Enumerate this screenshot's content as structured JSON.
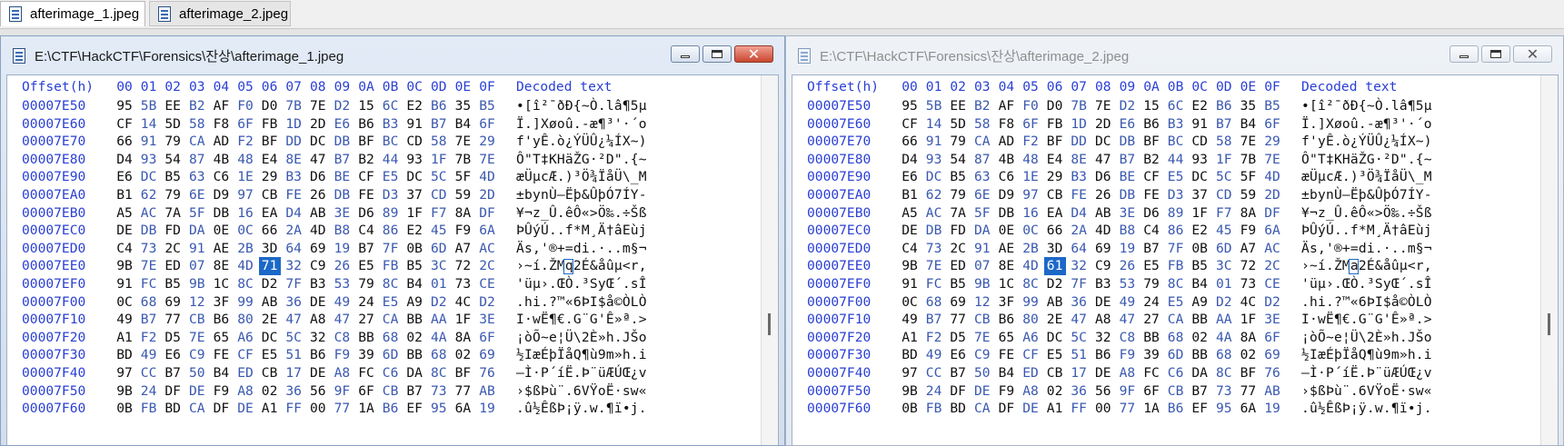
{
  "tabs": [
    {
      "label": "afterimage_1.jpeg",
      "active": true
    },
    {
      "label": "afterimage_2.jpeg",
      "active": false
    }
  ],
  "columns": {
    "offset_label": "Offset(h)",
    "hex": [
      "00",
      "01",
      "02",
      "03",
      "04",
      "05",
      "06",
      "07",
      "08",
      "09",
      "0A",
      "0B",
      "0C",
      "0D",
      "0E",
      "0F"
    ],
    "decoded_label": "Decoded text"
  },
  "windows": [
    {
      "title": "E:\\CTF\\HackCTF\\Forensics\\잔상\\afterimage_1.jpeg",
      "active": true,
      "rows": [
        {
          "offset": "00007E50",
          "bytes": [
            "95",
            "5B",
            "EE",
            "B2",
            "AF",
            "F0",
            "D0",
            "7B",
            "7E",
            "D2",
            "15",
            "6C",
            "E2",
            "B6",
            "35",
            "B5"
          ],
          "text": "•[î²¯ðÐ{~Ò.lâ¶5µ"
        },
        {
          "offset": "00007E60",
          "bytes": [
            "CF",
            "14",
            "5D",
            "58",
            "F8",
            "6F",
            "FB",
            "1D",
            "2D",
            "E6",
            "B6",
            "B3",
            "91",
            "B7",
            "B4",
            "6F"
          ],
          "text": "Ï.]Xøoû.-æ¶³'·´o"
        },
        {
          "offset": "00007E70",
          "bytes": [
            "66",
            "91",
            "79",
            "CA",
            "AD",
            "F2",
            "BF",
            "DD",
            "DC",
            "DB",
            "BF",
            "BC",
            "CD",
            "58",
            "7E",
            "29"
          ],
          "text": "f'yÊ.ò¿ÝÜÛ¿¼ÍX~)"
        },
        {
          "offset": "00007E80",
          "bytes": [
            "D4",
            "93",
            "54",
            "87",
            "4B",
            "48",
            "E4",
            "8E",
            "47",
            "B7",
            "B2",
            "44",
            "93",
            "1F",
            "7B",
            "7E"
          ],
          "text": "Ô\"T‡KHäŽG·²D\".{~"
        },
        {
          "offset": "00007E90",
          "bytes": [
            "E6",
            "DC",
            "B5",
            "63",
            "C6",
            "1E",
            "29",
            "B3",
            "D6",
            "BE",
            "CF",
            "E5",
            "DC",
            "5C",
            "5F",
            "4D"
          ],
          "text": "æÜµcÆ.)³Ö¾ÏåÜ\\_M"
        },
        {
          "offset": "00007EA0",
          "bytes": [
            "B1",
            "62",
            "79",
            "6E",
            "D9",
            "97",
            "CB",
            "FE",
            "26",
            "DB",
            "FE",
            "D3",
            "37",
            "CD",
            "59",
            "2D"
          ],
          "text": "±bynÙ—Ëþ&ÛþÓ7ÍY-"
        },
        {
          "offset": "00007EB0",
          "bytes": [
            "A5",
            "AC",
            "7A",
            "5F",
            "DB",
            "16",
            "EA",
            "D4",
            "AB",
            "3E",
            "D6",
            "89",
            "1F",
            "F7",
            "8A",
            "DF"
          ],
          "text": "¥¬z_Û.êÔ«>Ö‰.÷Šß"
        },
        {
          "offset": "00007EC0",
          "bytes": [
            "DE",
            "DB",
            "FD",
            "DA",
            "0E",
            "0C",
            "66",
            "2A",
            "4D",
            "B8",
            "C4",
            "86",
            "E2",
            "45",
            "F9",
            "6A"
          ],
          "text": "ÞÛýÚ..f*M¸Ä†âEùj"
        },
        {
          "offset": "00007ED0",
          "bytes": [
            "C4",
            "73",
            "2C",
            "91",
            "AE",
            "2B",
            "3D",
            "64",
            "69",
            "19",
            "B7",
            "7F",
            "0B",
            "6D",
            "A7",
            "AC"
          ],
          "text": "Äs,'®+=di.·..m§¬"
        },
        {
          "offset": "00007EE0",
          "bytes": [
            "9B",
            "7E",
            "ED",
            "07",
            "8E",
            "4D",
            "71",
            "32",
            "C9",
            "26",
            "E5",
            "FB",
            "B5",
            "3C",
            "72",
            "2C"
          ],
          "text": "›~í.ŽMq2É&åûµ<r,",
          "sel": 6
        },
        {
          "offset": "00007EF0",
          "bytes": [
            "91",
            "FC",
            "B5",
            "9B",
            "1C",
            "8C",
            "D2",
            "7F",
            "B3",
            "53",
            "79",
            "8C",
            "B4",
            "01",
            "73",
            "CE"
          ],
          "text": "'üµ›.ŒÒ.³SyŒ´.sÎ"
        },
        {
          "offset": "00007F00",
          "bytes": [
            "0C",
            "68",
            "69",
            "12",
            "3F",
            "99",
            "AB",
            "36",
            "DE",
            "49",
            "24",
            "E5",
            "A9",
            "D2",
            "4C",
            "D2"
          ],
          "text": ".hi.?™«6ÞI$å©ÒLÒ"
        },
        {
          "offset": "00007F10",
          "bytes": [
            "49",
            "B7",
            "77",
            "CB",
            "B6",
            "80",
            "2E",
            "47",
            "A8",
            "47",
            "27",
            "CA",
            "BB",
            "AA",
            "1F",
            "3E"
          ],
          "text": "I·wË¶€.G¨G'Ê»ª.>"
        },
        {
          "offset": "00007F20",
          "bytes": [
            "A1",
            "F2",
            "D5",
            "7E",
            "65",
            "A6",
            "DC",
            "5C",
            "32",
            "C8",
            "BB",
            "68",
            "02",
            "4A",
            "8A",
            "6F"
          ],
          "text": "¡òÕ~e¦Ü\\2È»h.JŠo"
        },
        {
          "offset": "00007F30",
          "bytes": [
            "BD",
            "49",
            "E6",
            "C9",
            "FE",
            "CF",
            "E5",
            "51",
            "B6",
            "F9",
            "39",
            "6D",
            "BB",
            "68",
            "02",
            "69"
          ],
          "text": "½IæÉþÏåQ¶ù9m»h.i"
        },
        {
          "offset": "00007F40",
          "bytes": [
            "97",
            "CC",
            "B7",
            "50",
            "B4",
            "ED",
            "CB",
            "17",
            "DE",
            "A8",
            "FC",
            "C6",
            "DA",
            "8C",
            "BF",
            "76"
          ],
          "text": "—Ì·P´íË.Þ¨üÆÚŒ¿v"
        },
        {
          "offset": "00007F50",
          "bytes": [
            "9B",
            "24",
            "DF",
            "DE",
            "F9",
            "A8",
            "02",
            "36",
            "56",
            "9F",
            "6F",
            "CB",
            "B7",
            "73",
            "77",
            "AB"
          ],
          "text": "›$ßÞù¨.6VŸoË·sw«"
        },
        {
          "offset": "00007F60",
          "bytes": [
            "0B",
            "FB",
            "BD",
            "CA",
            "DF",
            "DE",
            "A1",
            "FF",
            "00",
            "77",
            "1A",
            "B6",
            "EF",
            "95",
            "6A",
            "19"
          ],
          "text": ".û½ÊßÞ¡ÿ.w.¶ï•j."
        }
      ]
    },
    {
      "title": "E:\\CTF\\HackCTF\\Forensics\\잔상\\afterimage_2.jpeg",
      "active": false,
      "rows": [
        {
          "offset": "00007E50",
          "bytes": [
            "95",
            "5B",
            "EE",
            "B2",
            "AF",
            "F0",
            "D0",
            "7B",
            "7E",
            "D2",
            "15",
            "6C",
            "E2",
            "B6",
            "35",
            "B5"
          ],
          "text": "•[î²¯ðÐ{~Ò.lâ¶5µ"
        },
        {
          "offset": "00007E60",
          "bytes": [
            "CF",
            "14",
            "5D",
            "58",
            "F8",
            "6F",
            "FB",
            "1D",
            "2D",
            "E6",
            "B6",
            "B3",
            "91",
            "B7",
            "B4",
            "6F"
          ],
          "text": "Ï.]Xøoû.-æ¶³'·´o"
        },
        {
          "offset": "00007E70",
          "bytes": [
            "66",
            "91",
            "79",
            "CA",
            "AD",
            "F2",
            "BF",
            "DD",
            "DC",
            "DB",
            "BF",
            "BC",
            "CD",
            "58",
            "7E",
            "29"
          ],
          "text": "f'yÊ.ò¿ÝÜÛ¿¼ÍX~)"
        },
        {
          "offset": "00007E80",
          "bytes": [
            "D4",
            "93",
            "54",
            "87",
            "4B",
            "48",
            "E4",
            "8E",
            "47",
            "B7",
            "B2",
            "44",
            "93",
            "1F",
            "7B",
            "7E"
          ],
          "text": "Ô\"T‡KHäŽG·²D\".{~"
        },
        {
          "offset": "00007E90",
          "bytes": [
            "E6",
            "DC",
            "B5",
            "63",
            "C6",
            "1E",
            "29",
            "B3",
            "D6",
            "BE",
            "CF",
            "E5",
            "DC",
            "5C",
            "5F",
            "4D"
          ],
          "text": "æÜµcÆ.)³Ö¾ÏåÜ\\_M"
        },
        {
          "offset": "00007EA0",
          "bytes": [
            "B1",
            "62",
            "79",
            "6E",
            "D9",
            "97",
            "CB",
            "FE",
            "26",
            "DB",
            "FE",
            "D3",
            "37",
            "CD",
            "59",
            "2D"
          ],
          "text": "±bynÙ—Ëþ&ÛþÓ7ÍY-"
        },
        {
          "offset": "00007EB0",
          "bytes": [
            "A5",
            "AC",
            "7A",
            "5F",
            "DB",
            "16",
            "EA",
            "D4",
            "AB",
            "3E",
            "D6",
            "89",
            "1F",
            "F7",
            "8A",
            "DF"
          ],
          "text": "¥¬z_Û.êÔ«>Ö‰.÷Šß"
        },
        {
          "offset": "00007EC0",
          "bytes": [
            "DE",
            "DB",
            "FD",
            "DA",
            "0E",
            "0C",
            "66",
            "2A",
            "4D",
            "B8",
            "C4",
            "86",
            "E2",
            "45",
            "F9",
            "6A"
          ],
          "text": "ÞÛýÚ..f*M¸Ä†âEùj"
        },
        {
          "offset": "00007ED0",
          "bytes": [
            "C4",
            "73",
            "2C",
            "91",
            "AE",
            "2B",
            "3D",
            "64",
            "69",
            "19",
            "B7",
            "7F",
            "0B",
            "6D",
            "A7",
            "AC"
          ],
          "text": "Äs,'®+=di.·..m§¬"
        },
        {
          "offset": "00007EE0",
          "bytes": [
            "9B",
            "7E",
            "ED",
            "07",
            "8E",
            "4D",
            "61",
            "32",
            "C9",
            "26",
            "E5",
            "FB",
            "B5",
            "3C",
            "72",
            "2C"
          ],
          "text": "›~í.ŽMa2É&åûµ<r,",
          "sel": 6
        },
        {
          "offset": "00007EF0",
          "bytes": [
            "91",
            "FC",
            "B5",
            "9B",
            "1C",
            "8C",
            "D2",
            "7F",
            "B3",
            "53",
            "79",
            "8C",
            "B4",
            "01",
            "73",
            "CE"
          ],
          "text": "'üµ›.ŒÒ.³SyŒ´.sÎ"
        },
        {
          "offset": "00007F00",
          "bytes": [
            "0C",
            "68",
            "69",
            "12",
            "3F",
            "99",
            "AB",
            "36",
            "DE",
            "49",
            "24",
            "E5",
            "A9",
            "D2",
            "4C",
            "D2"
          ],
          "text": ".hi.?™«6ÞI$å©ÒLÒ"
        },
        {
          "offset": "00007F10",
          "bytes": [
            "49",
            "B7",
            "77",
            "CB",
            "B6",
            "80",
            "2E",
            "47",
            "A8",
            "47",
            "27",
            "CA",
            "BB",
            "AA",
            "1F",
            "3E"
          ],
          "text": "I·wË¶€.G¨G'Ê»ª.>"
        },
        {
          "offset": "00007F20",
          "bytes": [
            "A1",
            "F2",
            "D5",
            "7E",
            "65",
            "A6",
            "DC",
            "5C",
            "32",
            "C8",
            "BB",
            "68",
            "02",
            "4A",
            "8A",
            "6F"
          ],
          "text": "¡òÕ~e¦Ü\\2È»h.JŠo"
        },
        {
          "offset": "00007F30",
          "bytes": [
            "BD",
            "49",
            "E6",
            "C9",
            "FE",
            "CF",
            "E5",
            "51",
            "B6",
            "F9",
            "39",
            "6D",
            "BB",
            "68",
            "02",
            "69"
          ],
          "text": "½IæÉþÏåQ¶ù9m»h.i"
        },
        {
          "offset": "00007F40",
          "bytes": [
            "97",
            "CC",
            "B7",
            "50",
            "B4",
            "ED",
            "CB",
            "17",
            "DE",
            "A8",
            "FC",
            "C6",
            "DA",
            "8C",
            "BF",
            "76"
          ],
          "text": "—Ì·P´íË.Þ¨üÆÚŒ¿v"
        },
        {
          "offset": "00007F50",
          "bytes": [
            "9B",
            "24",
            "DF",
            "DE",
            "F9",
            "A8",
            "02",
            "36",
            "56",
            "9F",
            "6F",
            "CB",
            "B7",
            "73",
            "77",
            "AB"
          ],
          "text": "›$ßÞù¨.6VŸoË·sw«"
        },
        {
          "offset": "00007F60",
          "bytes": [
            "0B",
            "FB",
            "BD",
            "CA",
            "DF",
            "DE",
            "A1",
            "FF",
            "00",
            "77",
            "1A",
            "B6",
            "EF",
            "95",
            "6A",
            "19"
          ],
          "text": ".û½ÊßÞ¡ÿ.w.¶ï•j."
        }
      ]
    }
  ],
  "colors": {
    "offset_blue": "#2a3fd4",
    "selection": "#1c68c8",
    "alt_byte": "#3a58b0"
  },
  "icons": {
    "file": "file-icon",
    "minimize": "minimize-icon",
    "maximize": "maximize-icon",
    "close": "close-icon"
  }
}
